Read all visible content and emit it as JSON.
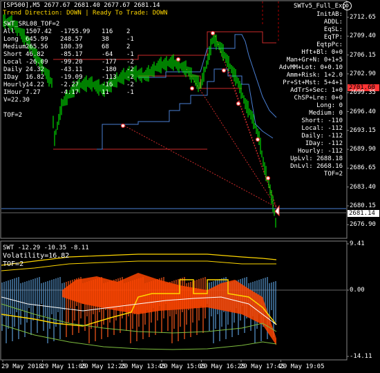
{
  "header": {
    "symbol_info": "[SP500],M5  2677.67 2681.40 2677.67 2681.14",
    "trend_text": "Trend Direction:  DOWN  |  Ready To Trade:  DOWN",
    "ea_name": "SWTv5_Full_Exp",
    "sub_label": "SWT_SRL08_TOF=2"
  },
  "stats": {
    "rows": [
      {
        "label": "All",
        "v1": "1507.42",
        "v2": "-1755.99",
        "v3": "116",
        "v4": "2"
      },
      {
        "label": "Long",
        "v1": "645.99",
        "v2": "248.57",
        "v3": "38",
        "v4": "-1"
      },
      {
        "label": "Medium",
        "v1": "265.56",
        "v2": "180.39",
        "v3": "68",
        "v4": "2"
      },
      {
        "label": "Short",
        "v1": "46.82",
        "v2": "-85.17",
        "v3": "-64",
        "v4": "-1"
      },
      {
        "label": "Local",
        "v1": "-26.09",
        "v2": "-99.20",
        "v3": "-177",
        "v4": "-2"
      },
      {
        "label": "Daily",
        "v1": "24.32",
        "v2": "-43.11",
        "v3": "-180",
        "v4": "-2"
      },
      {
        "label": "IDay",
        "v1": "16.82",
        "v2": "-19.09",
        "v3": "-113",
        "v4": "-2"
      },
      {
        "label": "Hourly",
        "v1": "14.22",
        "v2": "-2.27",
        "v3": "-16",
        "v4": "-2"
      },
      {
        "label": "IHour",
        "v1": "7.27",
        "v2": "-4.17",
        "v3": "11",
        "v4": "-1"
      }
    ],
    "extra1": "V=22.30",
    "extra2": "TOF=2"
  },
  "panel": {
    "rows": [
      "InitAB:",
      "ADDL:",
      "EqSL:",
      "EqTP:",
      "EqtpPc:",
      "Hft+Bl:  0+0",
      "Man+Gr+N:  0+1+5",
      "AdvMM+Lot:  0+0.10",
      "Amm+Risk:  1+2.0",
      "Pr+St+Mst:  5+4+1",
      "AdTrS+Sec:  1+0",
      "ChSP+Lre:  0+0",
      "Long:  0",
      "Medium:  0",
      "Short:  -110",
      "Local:  -112",
      "Daily:  -112",
      "IDay:  -112",
      "Hourly:  -112",
      "UpLvl:  2688.18",
      "DnLvl:  2668.16",
      "TOF=2"
    ]
  },
  "indicator": {
    "title": "SWT -12.29 -10.35 -8.11",
    "volatility": "Volatility=16.82",
    "tof": "TOF=2",
    "axis": [
      "9.41",
      "0.00",
      "-14.11"
    ]
  },
  "price_axis": [
    "2712.65",
    "2709.40",
    "2706.15",
    "2702.90",
    "2699.35",
    "2696.40",
    "2693.15",
    "2689.90",
    "2686.65",
    "2683.40",
    "2680.15",
    "2676.90"
  ],
  "price_boxes": {
    "red": "2701.60",
    "current": "2681.14"
  },
  "time_axis": [
    "29 May 2018",
    "29 May 11:05",
    "29 May 12:25",
    "29 May 13:45",
    "29 May 15:05",
    "29 May 16:25",
    "29 May 17:45",
    "29 May 19:05"
  ],
  "colors": {
    "background": "#000000",
    "candle": "#00ff00",
    "red_line": "#ff3333",
    "blue_line": "#4a7fd4",
    "yellow": "#ffd700",
    "orange_fill": "#ff4500",
    "histogram_blue": "#5b9bd5"
  }
}
